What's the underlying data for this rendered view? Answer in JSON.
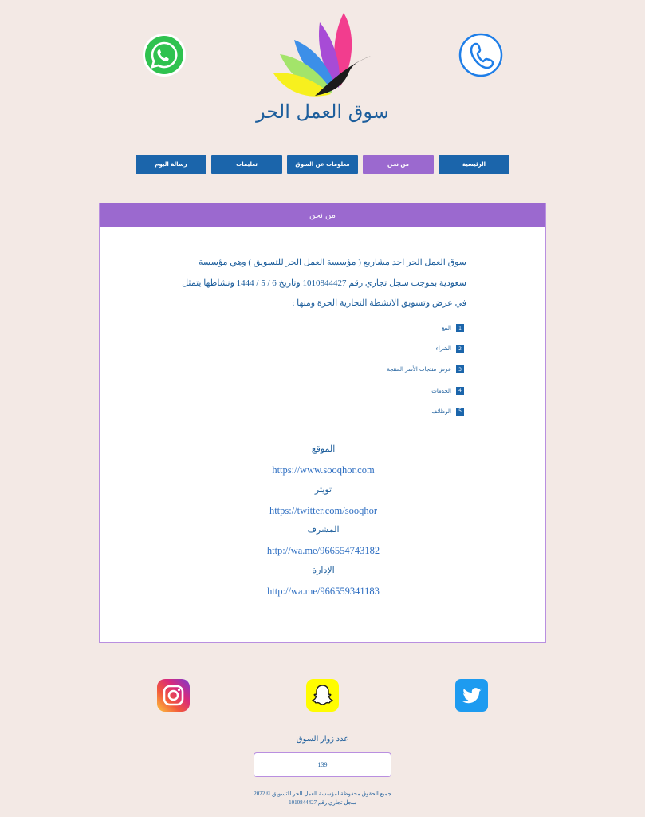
{
  "header": {
    "site_title": "سوق العمل الحر",
    "whatsapp_icon": "whatsapp-icon",
    "phone_icon": "phone-icon",
    "logo_icon": "lotus-logo"
  },
  "nav": {
    "items": [
      {
        "label": "الرئيسية",
        "active": false
      },
      {
        "label": "من نحن",
        "active": true
      },
      {
        "label": "معلومات عن السوق",
        "active": false
      },
      {
        "label": "تعليمات",
        "active": false
      },
      {
        "label": "رسالة اليوم",
        "active": false
      }
    ]
  },
  "card": {
    "title": "من نحن",
    "intro": "سوق العمل الحر احد مشاريع ( مؤسسة العمل الحر للتسويق ) وهي مؤسسة سعودية بموجب سجل تجاري رقم 1010844427 وتاريخ 6 / 5 / 1444 ونشاطها يتمثل في عرض وتسويق الانشطة التجارية الحرة ومنها :",
    "activities": [
      {
        "num": "1",
        "label": "البيع"
      },
      {
        "num": "2",
        "label": "الشراء"
      },
      {
        "num": "3",
        "label": "عرض منتجات الأسر المنتجة"
      },
      {
        "num": "4",
        "label": "الخدمات"
      },
      {
        "num": "5",
        "label": "الوظائف"
      }
    ],
    "links": [
      {
        "label": "الموقع",
        "url": "https://www.sooqhor.com"
      },
      {
        "label": "تويتر",
        "url": "https://twitter.com/sooqhor"
      },
      {
        "label": "المشرف",
        "url": "http://wa.me/966554743182"
      },
      {
        "label": "الإدارة",
        "url": "http://wa.me/966559341183"
      }
    ]
  },
  "social": {
    "instagram": "instagram-icon",
    "snapchat": "snapchat-icon",
    "twitter": "twitter-icon"
  },
  "counter": {
    "label": "عدد زوار السوق",
    "value": "139"
  },
  "footer": {
    "line1": "جميع الحقوق محفوظة لمؤسسة العمل الحر للتسويق © 2022",
    "line2": "سجل تجاري رقم 1010844427"
  },
  "colors": {
    "background": "#f3e9e5",
    "primary_blue": "#1b65ab",
    "active_purple": "#9b69cf",
    "text_blue": "#1d5e9c"
  }
}
